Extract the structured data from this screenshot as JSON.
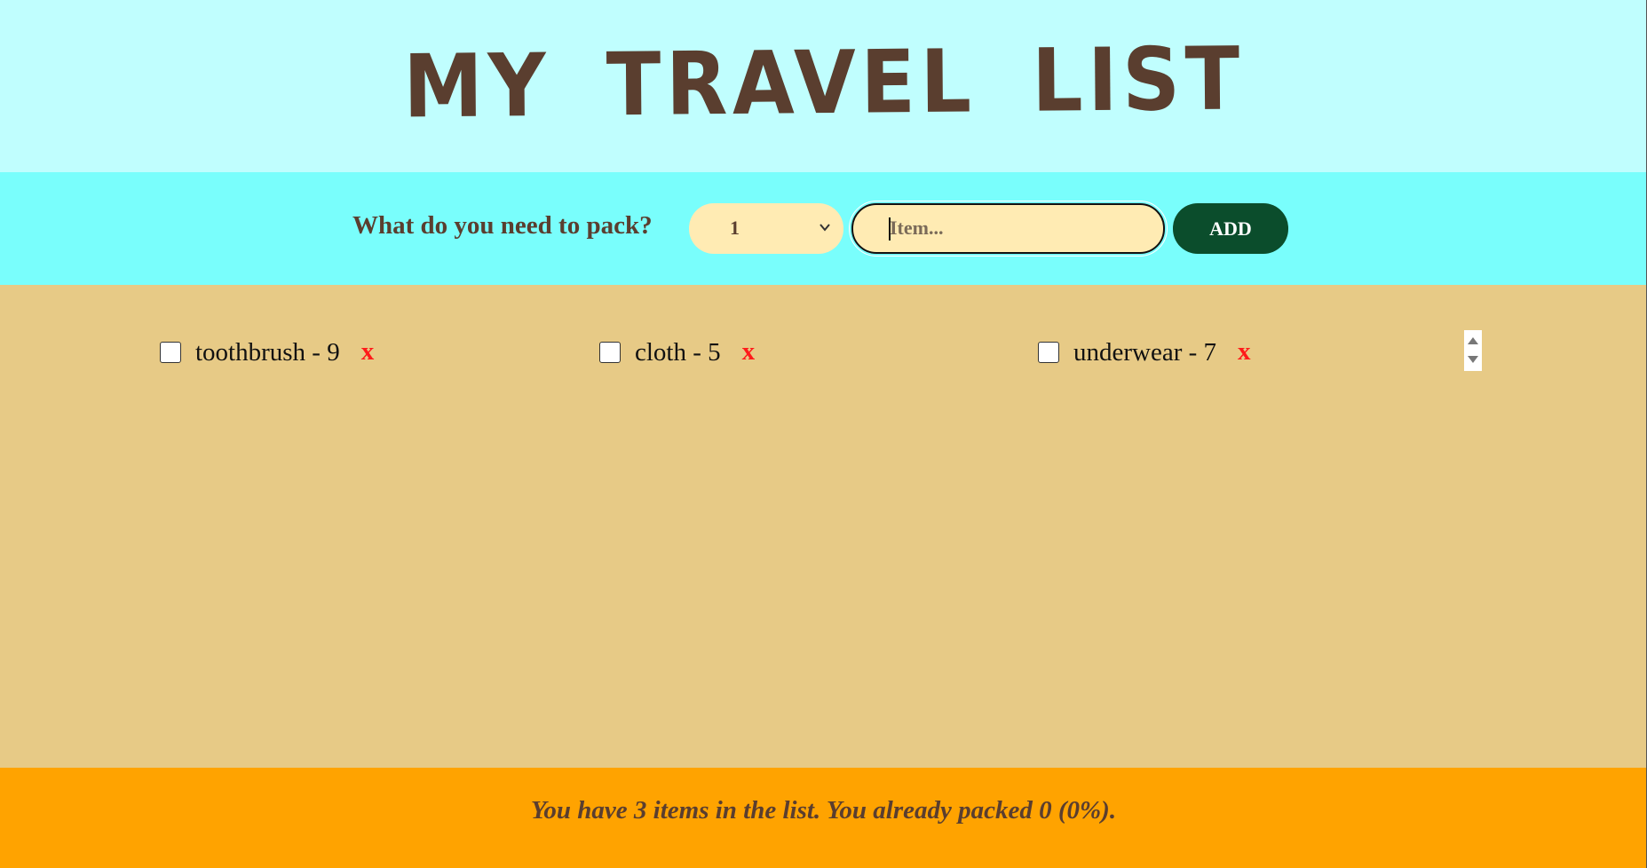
{
  "header": {
    "title": "MY TRAVEL LIST"
  },
  "form": {
    "prompt": "What do you need to pack?",
    "quantity_selected": "1",
    "item_placeholder": "Item...",
    "add_label": "ADD"
  },
  "items": [
    {
      "label": "toothbrush - 9",
      "remove_label": "x",
      "packed": false
    },
    {
      "label": "cloth - 5",
      "remove_label": "x",
      "packed": false
    },
    {
      "label": "underwear - 7",
      "remove_label": "x",
      "packed": false
    }
  ],
  "footer": {
    "stats": "You have 3 items in the list. You already packed 0 (0%)."
  },
  "colors": {
    "header_bg": "#c0fefe",
    "form_bg": "#79fefc",
    "list_bg": "#e7ca86",
    "footer_bg": "#ffa300",
    "text_brown": "#5a3e2f",
    "input_bg": "#ffebb3",
    "button_green": "#0b4d2c",
    "remove_red": "#ff1a1a"
  }
}
